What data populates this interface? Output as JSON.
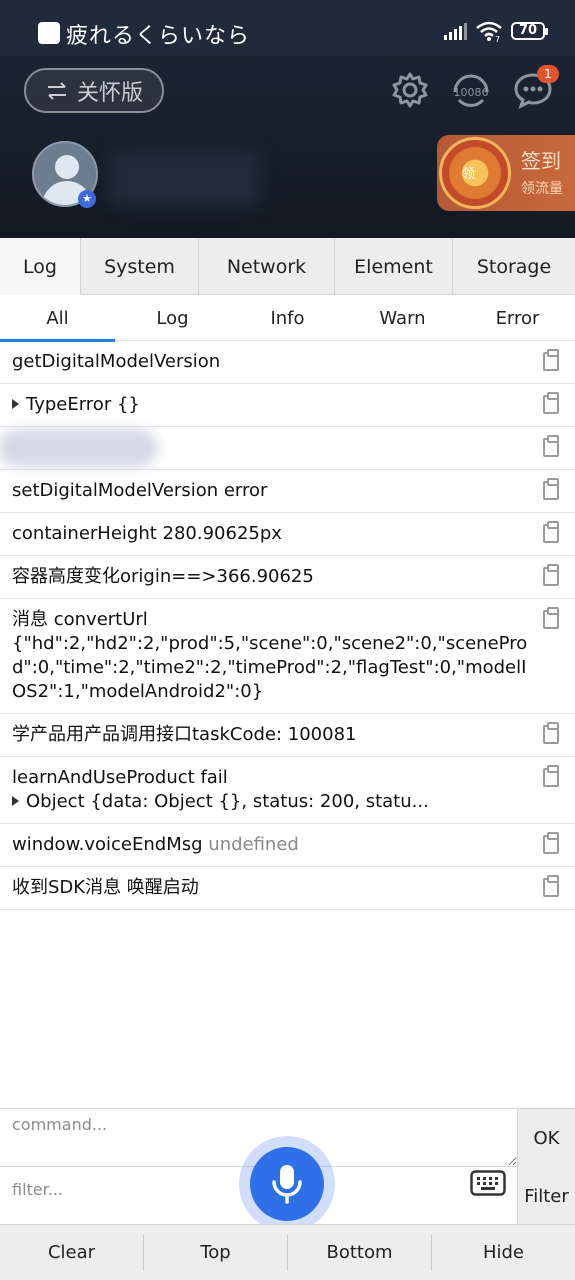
{
  "status_bar": {
    "title": "疲れるくらいなら",
    "battery": "70",
    "wifi_label": "7"
  },
  "app_header": {
    "care_mode_label": "关怀版",
    "service_number": "10086",
    "message_badge": "1",
    "sign_in_title": "签到",
    "sign_in_sub": "领流量",
    "wheel_label": "领"
  },
  "console": {
    "tabs": [
      {
        "label": "Log",
        "active": true
      },
      {
        "label": "System",
        "active": false
      },
      {
        "label": "Network",
        "active": false
      },
      {
        "label": "Element",
        "active": false
      },
      {
        "label": "Storage",
        "active": false
      }
    ],
    "subtabs": [
      {
        "label": "All",
        "active": true
      },
      {
        "label": "Log",
        "active": false
      },
      {
        "label": "Info",
        "active": false
      },
      {
        "label": "Warn",
        "active": false
      },
      {
        "label": "Error",
        "active": false
      }
    ],
    "logs": [
      {
        "text": "getDigitalModelVersion"
      },
      {
        "text": "TypeError {}"
      },
      {
        "text": ""
      },
      {
        "text": "setDigitalModelVersion error"
      },
      {
        "text": "containerHeight 280.90625px"
      },
      {
        "text": "容器高度变化origin==>366.90625"
      },
      {
        "line1": "消息 convertUrl",
        "line2": "{\"hd\":2,\"hd2\":2,\"prod\":5,\"scene\":0,\"scene2\":0,\"sceneProd\":0,\"time\":2,\"time2\":2,\"timeProd\":2,\"flagTest\":0,\"modelIOS2\":1,\"modelAndroid2\":0}"
      },
      {
        "text": "学产品用产品调用接口taskCode: 100081"
      },
      {
        "line1": "learnAndUseProduct fail",
        "line2": "Object {data: Object {}, status: 200, statu..."
      },
      {
        "text": "window.voiceEndMsg",
        "muted": "undefined"
      },
      {
        "text": "收到SDK消息 唤醒启动"
      }
    ],
    "command_placeholder": "command...",
    "filter_placeholder": "filter...",
    "ok_label": "OK",
    "filter_label": "Filter",
    "footer": [
      "Clear",
      "Top",
      "Bottom",
      "Hide"
    ]
  },
  "colors": {
    "accent": "#2b7de9",
    "mic": "#2f6fe8",
    "header_bg": "#1e2634",
    "badge": "#e2542e"
  }
}
